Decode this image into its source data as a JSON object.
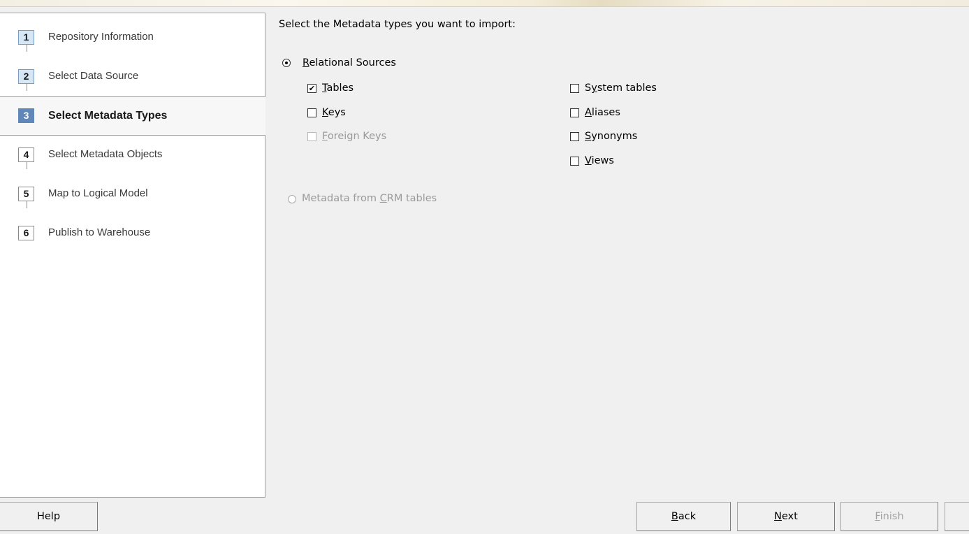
{
  "steps": [
    {
      "num": "1",
      "label": "Repository Information",
      "state": "done"
    },
    {
      "num": "2",
      "label": "Select Data Source",
      "state": "done"
    },
    {
      "num": "3",
      "label": "Select Metadata Types",
      "state": "active"
    },
    {
      "num": "4",
      "label": "Select Metadata Objects",
      "state": "pending"
    },
    {
      "num": "5",
      "label": "Map to Logical Model",
      "state": "pending"
    },
    {
      "num": "6",
      "label": "Publish to Warehouse",
      "state": "pending"
    }
  ],
  "main": {
    "heading": "Select the Metadata types you want to import:",
    "relational": {
      "key": "R",
      "rest": "elational Sources",
      "selected": true
    },
    "options_left": [
      {
        "key": "T",
        "rest": "ables",
        "checked": true,
        "disabled": false
      },
      {
        "key": "K",
        "rest": "eys",
        "checked": false,
        "disabled": false
      },
      {
        "key": "F",
        "rest": "oreign Keys",
        "checked": false,
        "disabled": true
      }
    ],
    "options_right": [
      {
        "pre": "S",
        "key": "y",
        "rest": "stem tables",
        "checked": false
      },
      {
        "pre": "",
        "key": "A",
        "rest": "liases",
        "checked": false
      },
      {
        "pre": "",
        "key": "S",
        "rest": "ynonyms",
        "checked": false
      },
      {
        "pre": "",
        "key": "V",
        "rest": "iews",
        "checked": false
      }
    ],
    "crm": {
      "pre": "Metadata from ",
      "key": "C",
      "rest": "RM tables",
      "selected": false,
      "disabled": true
    }
  },
  "buttons": {
    "help": "Help",
    "back": {
      "key": "B",
      "rest": "ack"
    },
    "next": {
      "key": "N",
      "rest": "ext"
    },
    "finish": {
      "key": "F",
      "rest": "inish"
    }
  }
}
